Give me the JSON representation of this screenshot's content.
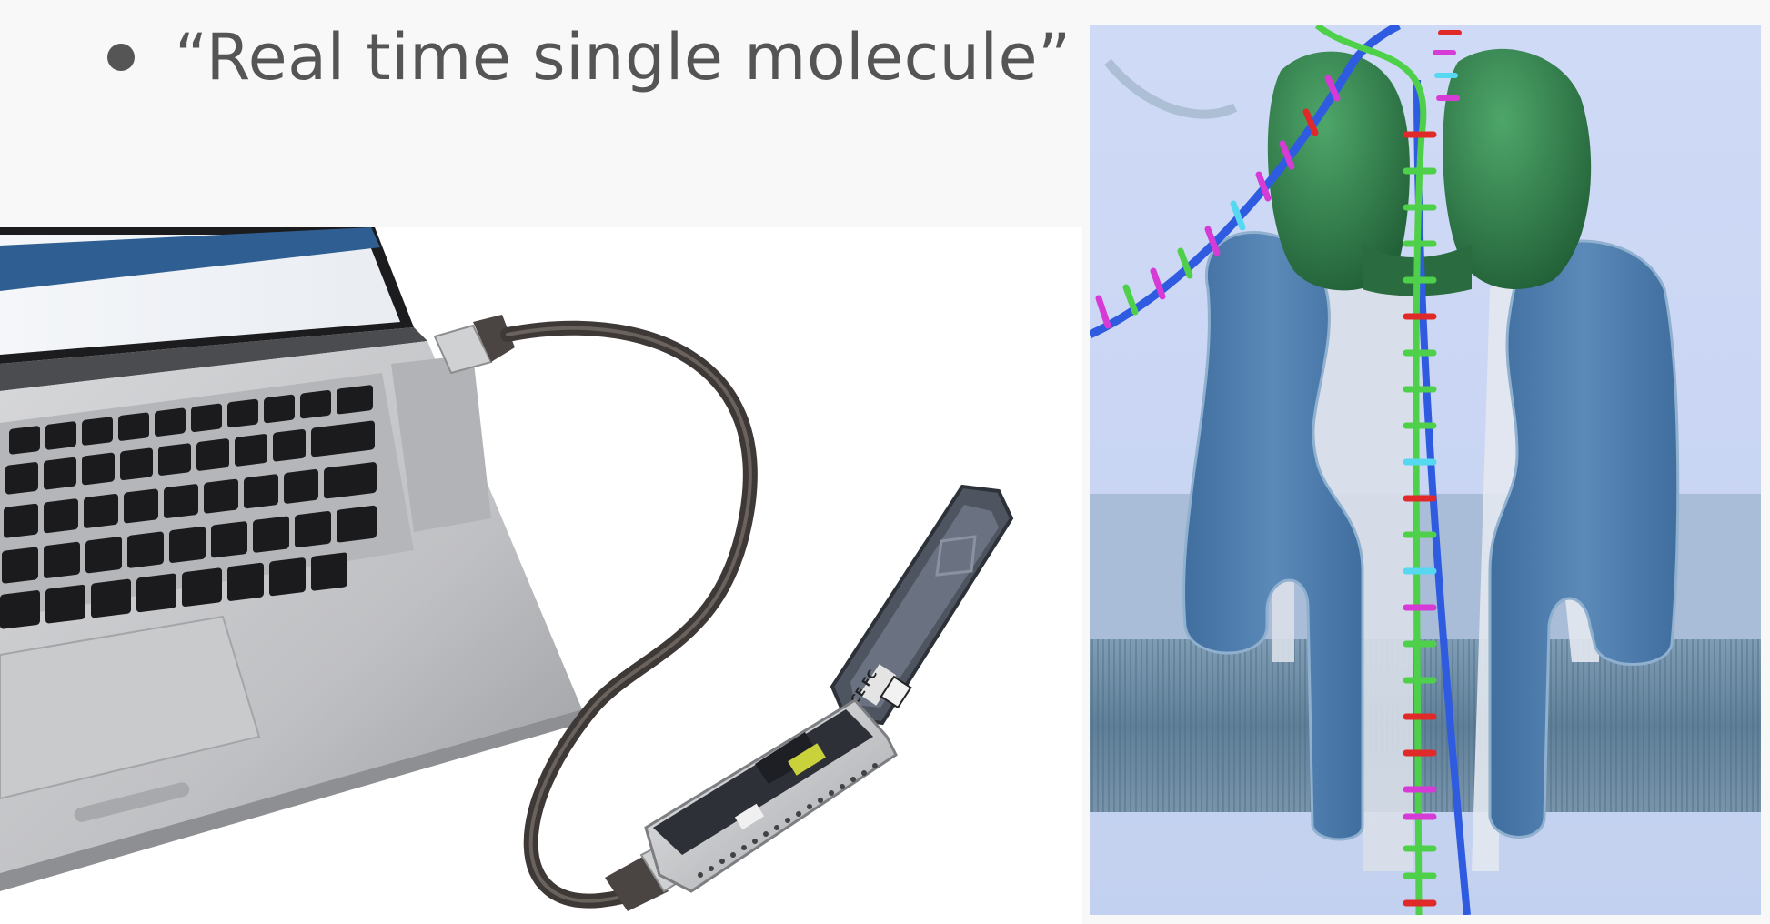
{
  "slide": {
    "bullet": "“Real time single molecule”"
  },
  "images": {
    "left": {
      "icon": "laptop-with-usb-sequencer",
      "device_label": "CE FC"
    },
    "right": {
      "icon": "protein-nanopore-with-dna-strand"
    }
  },
  "colors": {
    "text": "#555555",
    "background": "#f8f8f8",
    "pore_blue": "#4a7bb0",
    "motor_green": "#2f7a45",
    "strand_green": "#4fd04a",
    "strand_blue": "#2f5be0"
  }
}
